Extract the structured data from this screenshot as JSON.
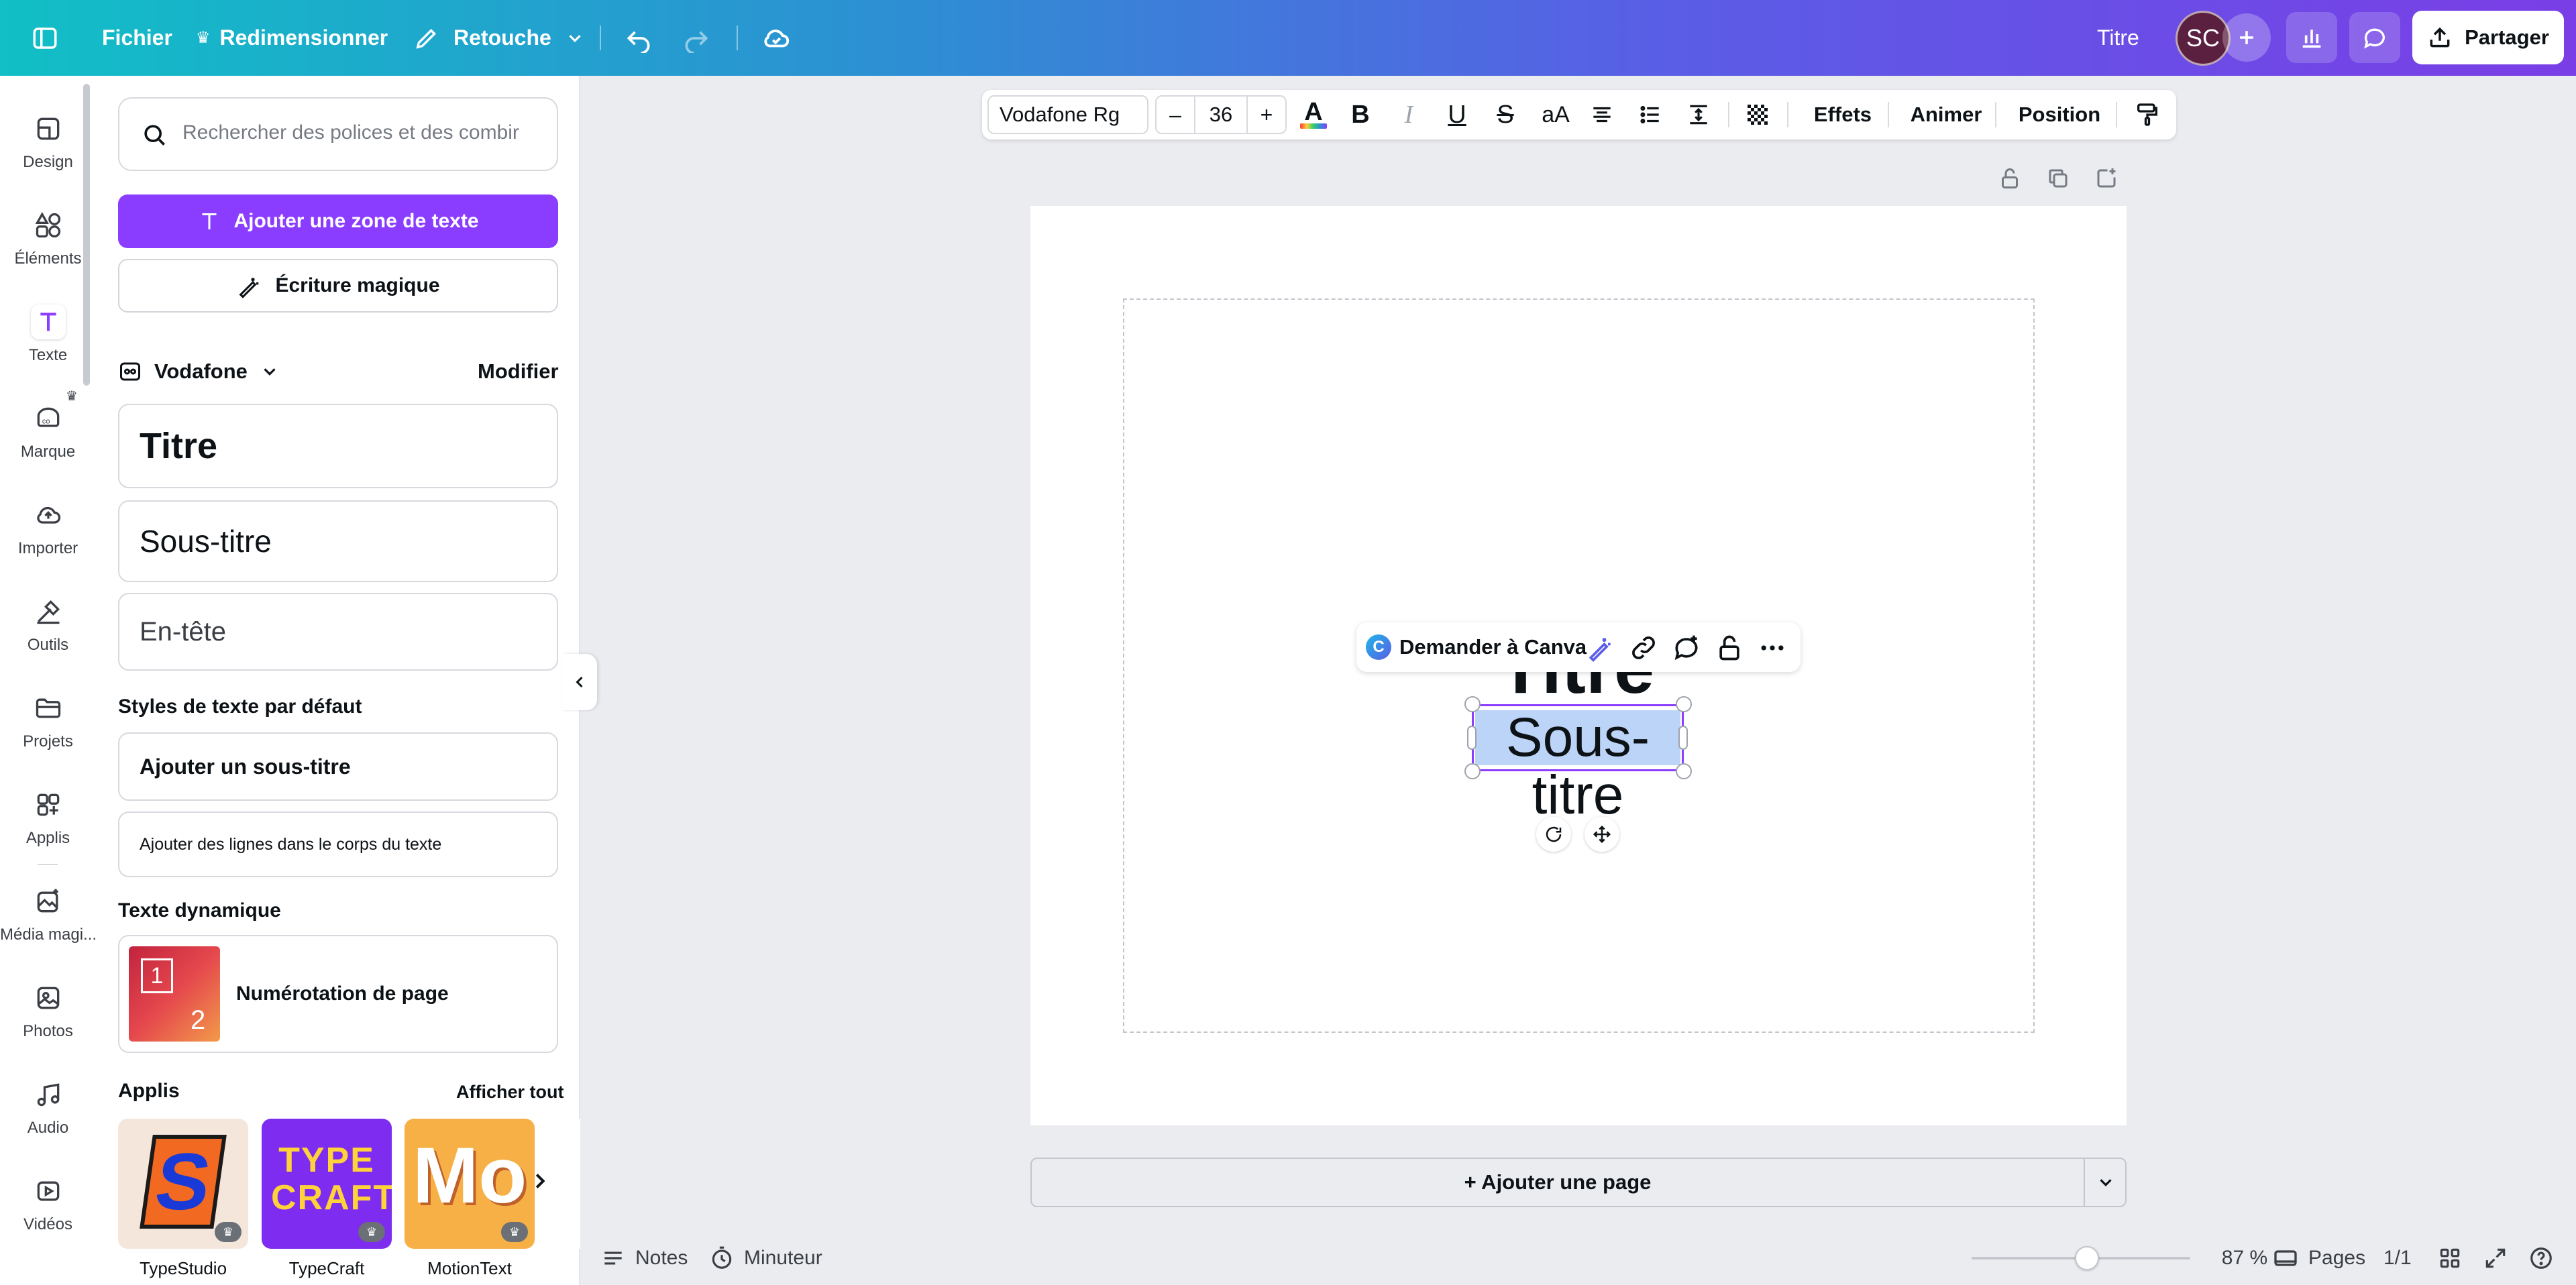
{
  "header": {
    "file_label": "Fichier",
    "resize_label": "Redimensionner",
    "retouch_label": "Retouche",
    "doc_title": "Titre",
    "avatar_initials": "SC",
    "share_label": "Partager"
  },
  "rail": [
    {
      "label": "Design",
      "icon": "design-icon"
    },
    {
      "label": "Éléments",
      "icon": "elements-icon"
    },
    {
      "label": "Texte",
      "icon": "text-icon"
    },
    {
      "label": "Marque",
      "icon": "brand-icon"
    },
    {
      "label": "Importer",
      "icon": "upload-icon"
    },
    {
      "label": "Outils",
      "icon": "tools-icon"
    },
    {
      "label": "Projets",
      "icon": "folder-icon"
    },
    {
      "label": "Applis",
      "icon": "apps-icon"
    },
    {
      "label": "Média magi...",
      "icon": "magic-media-icon"
    },
    {
      "label": "Photos",
      "icon": "photos-icon"
    },
    {
      "label": "Audio",
      "icon": "audio-icon"
    },
    {
      "label": "Vidéos",
      "icon": "videos-icon"
    }
  ],
  "panel": {
    "search_placeholder": "Rechercher des polices et des combir",
    "add_text_box": "Ajouter une zone de texte",
    "magic_write": "Écriture magique",
    "brand_kit_name": "Vodafone",
    "edit_label": "Modifier",
    "brand_styles": {
      "title": "Titre",
      "subtitle": "Sous-titre",
      "heading": "En-tête"
    },
    "default_styles_title": "Styles de texte par défaut",
    "add_subtitle": "Ajouter un sous-titre",
    "add_body": "Ajouter des lignes dans le corps du texte",
    "dynamic_text_title": "Texte dynamique",
    "page_numbering": "Numérotation de page",
    "page_numbering_thumb": {
      "top": "1",
      "bottom": "2"
    },
    "apps_title": "Applis",
    "show_all": "Afficher tout",
    "apps": [
      {
        "name": "TypeStudio",
        "art": "S"
      },
      {
        "name": "TypeCraft",
        "art": "TYPE CRAFT"
      },
      {
        "name": "MotionText",
        "art": "Mo"
      }
    ]
  },
  "toolbar": {
    "font_name": "Vodafone Rg",
    "font_size": "36",
    "minus": "–",
    "plus": "+",
    "case_label": "aA",
    "effects": "Effets",
    "animate": "Animer",
    "position": "Position"
  },
  "canvas": {
    "title_text": "Titre",
    "subtitle_text": "Sous-titre",
    "ask_canva": "Demander à Canva",
    "add_page": "+ Ajouter une page"
  },
  "bottom": {
    "notes": "Notes",
    "timer": "Minuteur",
    "zoom_percent": 87,
    "zoom": "87 %",
    "pages_label": "Pages",
    "page_count": "1/1"
  },
  "colors": {
    "accent": "#8b3dff",
    "selection": "#8b3dff",
    "text_highlight": "#bcd4f7"
  }
}
